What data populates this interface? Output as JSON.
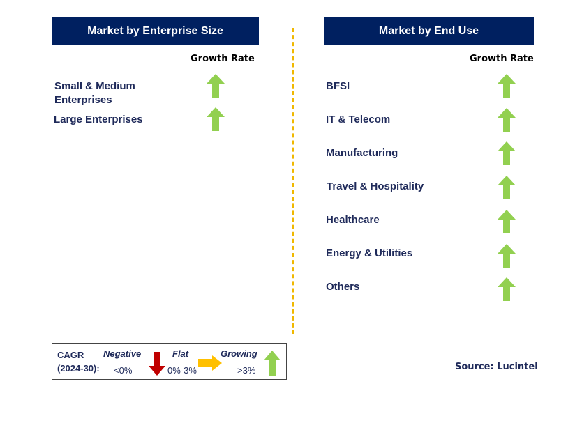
{
  "left": {
    "title": "Market by Enterprise Size",
    "growth_header": "Growth Rate",
    "items": [
      {
        "label_1": "Small & Medium",
        "label_2": "Enterprises",
        "trend": "growing"
      },
      {
        "label": "Large Enterprises",
        "trend": "growing"
      }
    ]
  },
  "right": {
    "title": "Market by End Use",
    "growth_header": "Growth Rate",
    "items": [
      {
        "label": "BFSI",
        "trend": "growing"
      },
      {
        "label": "IT & Telecom",
        "trend": "growing"
      },
      {
        "label": "Manufacturing",
        "trend": "growing"
      },
      {
        "label": "Travel & Hospitality",
        "trend": "growing"
      },
      {
        "label": "Healthcare",
        "trend": "growing"
      },
      {
        "label": "Energy & Utilities",
        "trend": "growing"
      },
      {
        "label": "Others",
        "trend": "growing"
      }
    ]
  },
  "legend": {
    "cagr_1": "CAGR",
    "cagr_2": "(2024-30):",
    "negative": "Negative",
    "negative_range": "<0%",
    "flat": "Flat",
    "flat_range": "0%-3%",
    "growing": "Growing",
    "growing_range": ">3%"
  },
  "source": "Source: Lucintel",
  "colors": {
    "header": "#002060",
    "growing": "#92d050",
    "flat": "#ffc000",
    "negative": "#c00000",
    "divider": "#f0b800"
  }
}
